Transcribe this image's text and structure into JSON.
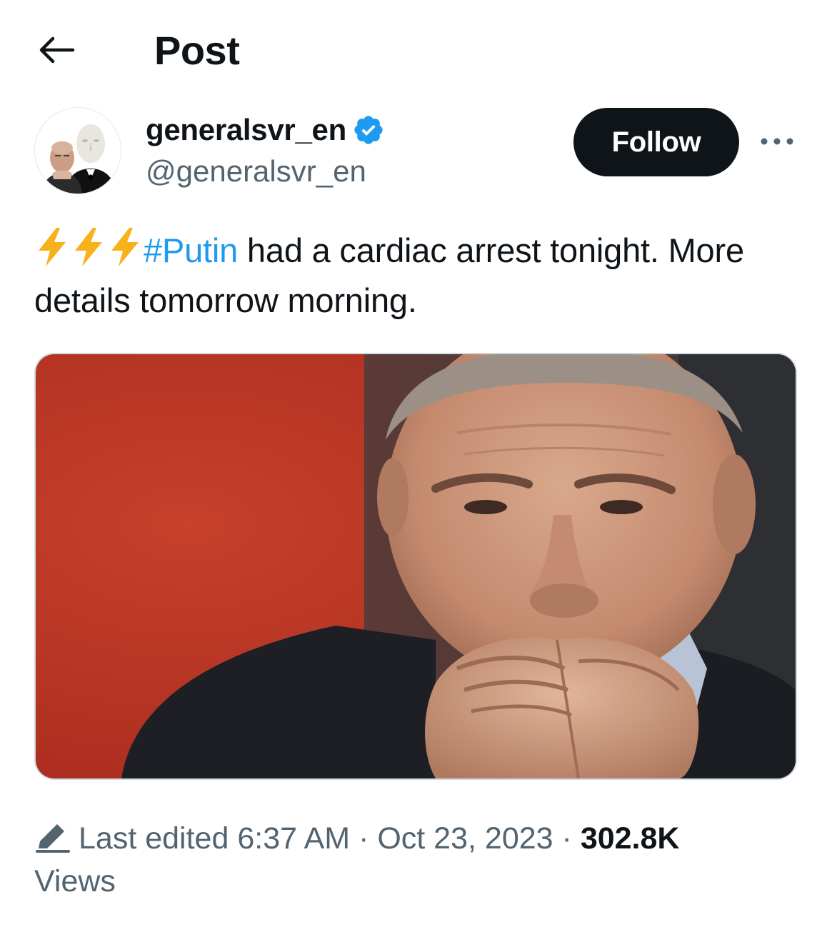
{
  "header": {
    "back_icon": "arrow-left-icon",
    "title": "Post"
  },
  "author": {
    "display_name": "generalsvr_en",
    "handle": "@generalsvr_en",
    "verified_icon": "verified-badge-icon",
    "verified_color": "#1d9bf0"
  },
  "actions": {
    "follow_label": "Follow",
    "more_icon": "more-dots-icon"
  },
  "tweet": {
    "emoji_icon": "high-voltage-icon",
    "hashtag": "#Putin",
    "text_after_hashtag": " had a cardiac arrest tonight. More details tomorrow morning.",
    "hashtag_color": "#1d9bf0"
  },
  "media": {
    "alt": "photo"
  },
  "meta": {
    "edit_icon": "pencil-icon",
    "last_edited_label": "Last edited",
    "time": "6:37 AM",
    "separator": "·",
    "date": "Oct 23, 2023",
    "views_count": "302.8K",
    "views_label": "Views"
  }
}
